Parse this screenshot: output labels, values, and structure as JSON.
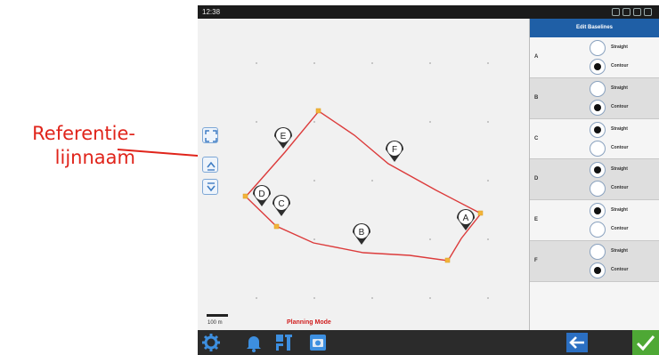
{
  "annotation": {
    "callout_line1": "Referentie-",
    "callout_line2": "lijnnaam",
    "color": "#e0241b"
  },
  "statusbar": {
    "time": "12:38"
  },
  "map": {
    "scale_label": "100 m",
    "mode_label": "Planning Mode",
    "pins": [
      "A",
      "B",
      "C",
      "D",
      "E",
      "F"
    ],
    "tools": [
      "fit-to-screen-icon",
      "zoom-in-icon",
      "zoom-out-icon"
    ]
  },
  "panel": {
    "title": "Edit Baselines",
    "header_color": "#1f5fa6",
    "rows": [
      {
        "letter": "A",
        "straight_label": "Straight",
        "contour_label": "Contour",
        "selected": "contour"
      },
      {
        "letter": "B",
        "straight_label": "Straight",
        "contour_label": "Contour",
        "selected": "contour"
      },
      {
        "letter": "C",
        "straight_label": "Straight",
        "contour_label": "Contour",
        "selected": "straight"
      },
      {
        "letter": "D",
        "straight_label": "Straight",
        "contour_label": "Contour",
        "selected": "straight"
      },
      {
        "letter": "E",
        "straight_label": "Straight",
        "contour_label": "Contour",
        "selected": "straight"
      },
      {
        "letter": "F",
        "straight_label": "Straight",
        "contour_label": "Contour",
        "selected": "contour"
      }
    ]
  },
  "toolbar": {
    "buttons": [
      "settings-icon",
      "alerts-bell-icon",
      "guidance-icon",
      "camera-icon"
    ],
    "back": "back-arrow-icon",
    "confirm": "checkmark-icon",
    "confirm_color": "#4ea835"
  }
}
